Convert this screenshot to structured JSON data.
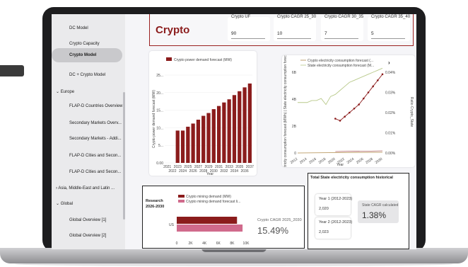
{
  "sidebar": {
    "items": [
      {
        "label": "DC Model",
        "kind": "page"
      },
      {
        "label": "Crypto Capacity",
        "kind": "page"
      },
      {
        "label": "Crypto Model",
        "kind": "page",
        "active": true
      },
      {
        "label": "DC + Crypto Model",
        "kind": "page"
      },
      {
        "label": "⌄ Europe",
        "kind": "group"
      },
      {
        "label": "FLAP-D Countries Overview",
        "kind": "page"
      },
      {
        "label": "Secondary Markets Overv...",
        "kind": "page"
      },
      {
        "label": "Secondary Markets - Addi...",
        "kind": "page"
      },
      {
        "label": "FLAP-D Cities and Secon...",
        "kind": "page"
      },
      {
        "label": "FLAP-D Cities and Secon...",
        "kind": "page"
      },
      {
        "label": "› Asia, Middle-East and Latin ...",
        "kind": "group"
      },
      {
        "label": "⌄ Global",
        "kind": "group"
      },
      {
        "label": "Global Overview [1]",
        "kind": "page"
      },
      {
        "label": "Global Overview [2]",
        "kind": "page"
      }
    ]
  },
  "header": {
    "title": "Crypto",
    "kpis": [
      {
        "label": "Crypto UF",
        "value": "90"
      },
      {
        "label": "Crypto CAGR 25_30",
        "value": "10"
      },
      {
        "label": "Crypto CAGR 30_35",
        "value": "7"
      },
      {
        "label": "Crypto CAGR 35_40",
        "value": "5"
      }
    ]
  },
  "colors": {
    "accent": "#8b1c1c",
    "bar": "#8b1c1c",
    "bar_pink": "#d06a8c",
    "line_green": "#b8c98a"
  },
  "chart_data": [
    {
      "type": "bar",
      "title": "",
      "legend": "Crypto power demand forecast (MW)",
      "ylabel": "Crypto power demand forecast (MW)",
      "xlabel": "Year",
      "ytick_labels": [
        "0.00",
        "5...",
        "10...",
        "15...",
        "20...",
        "25..."
      ],
      "ylim": [
        0,
        25
      ],
      "categories": [
        "2021",
        "2022",
        "2023",
        "2024",
        "2025",
        "2026",
        "2027",
        "2028",
        "2029",
        "2030",
        "2031",
        "2032",
        "2033",
        "2034",
        "2035",
        "2036",
        "2037"
      ],
      "values": [
        0,
        0,
        9.2,
        9.2,
        10.3,
        11.2,
        12.3,
        13.4,
        14.2,
        15.3,
        16.2,
        17.2,
        18.1,
        19.3,
        20.4,
        21.5,
        22.6
      ]
    },
    {
      "type": "line",
      "legend": [
        "Crypto electricity consumption forecast (...",
        "State electricity consumption forecast (M..."
      ],
      "ylabel": "Crypto electricity consumption forecast (MWh) | State electricity consumption forecast (MWh)",
      "y2label": "Ratio Crypto_State",
      "xlabel": "Year",
      "ytick_labels": [
        "0",
        "2B",
        "4B",
        "6B"
      ],
      "y2tick_labels": [
        "0.00%",
        "0.01%",
        "0.02%",
        "0.03%",
        "0.04%"
      ],
      "categories": [
        "2012",
        "2014",
        "2016",
        "2018",
        "2020",
        "2022",
        "2024",
        "2026",
        "2028",
        "2030"
      ],
      "ratio_x": [
        2020,
        2021,
        2022,
        2023,
        2024,
        2025,
        2026,
        2027,
        2028,
        2029,
        2030
      ],
      "ratio_values_pct": [
        0.017,
        0.016,
        0.018,
        0.02,
        0.022,
        0.024,
        0.027,
        0.03,
        0.033,
        0.036,
        0.039
      ],
      "green_x": [
        2012,
        2013,
        2014,
        2015,
        2016,
        2017,
        2018,
        2019,
        2020,
        2021,
        2022,
        2023,
        2024,
        2025,
        2026,
        2027,
        2028,
        2029,
        2030
      ],
      "green_values_pct": [
        0.025,
        0.025,
        0.025,
        0.026,
        0.026,
        0.027,
        0.024,
        0.028,
        0.029,
        0.031,
        0.033,
        0.035,
        0.036,
        0.037,
        0.038,
        0.039,
        0.04,
        0.041,
        0.042
      ]
    },
    {
      "type": "bar",
      "orientation": "horizontal",
      "legend": [
        "Crypto mining demand (MW)",
        "Crypto mining demand forecast li..."
      ],
      "categories": [
        "US"
      ],
      "xtick_labels": [
        "0",
        "2K",
        "4K",
        "6K",
        "8K",
        "10K"
      ],
      "xlim": [
        0,
        10000
      ],
      "series": [
        {
          "name": "Crypto mining demand (MW)",
          "values": [
            8700
          ]
        },
        {
          "name": "Crypto mining demand forecast li...",
          "values": [
            9500
          ]
        }
      ]
    }
  ],
  "research": {
    "title_line1": "Research",
    "title_line2": "2026-2030",
    "cagr_label": "Crypto CAGR 2025_2030",
    "cagr_value": "15.49%"
  },
  "total": {
    "title": "Total State electricity consumption historical",
    "year1_label": "Year 1 (2012-2023)",
    "year1_value": "2,020",
    "year2_label": "Year 2 (2012-2023)",
    "year2_value": "2,023",
    "cagr_label": "State CAGR calculated",
    "cagr_value": "1.38%"
  },
  "chart_nav": "›"
}
